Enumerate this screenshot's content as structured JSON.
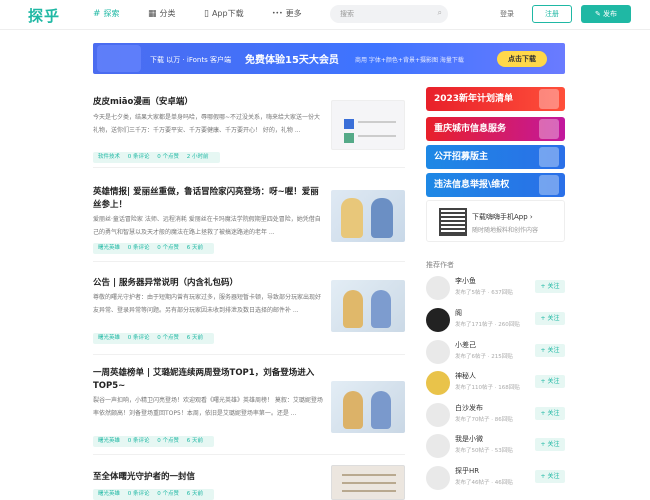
{
  "header": {
    "logo": "探乎",
    "nav": [
      {
        "icon": "#",
        "label": "探索"
      },
      {
        "icon": "▦",
        "label": "分类"
      },
      {
        "icon": "▯",
        "label": "App下载"
      },
      {
        "icon": "•••",
        "label": "更多"
      }
    ],
    "search_placeholder": "搜索",
    "login": "登录",
    "register": "注册",
    "publish": "发布"
  },
  "banner": {
    "left_text": "下载 以万 · iFonts 客户端",
    "main_text": "免费体验15天大会员",
    "sub_text": "商用 字体+颜色+背景+摄影图 海量下载",
    "cta": "点击下载"
  },
  "articles": [
    {
      "title": "皮皮miāo漫画（安卓端）",
      "desc": "今天是七夕类，结果大家都是单身吗哈，辱哪假哪~不过没关系，嗨来给大家送一份大礼物，送你们三千万：千万要平安、千万要健康、千万要开心！ 好的，礼物 ...",
      "tag": "软件技术",
      "comments": "0 条评论",
      "likes": "0 个点赞",
      "time": "2 小时前"
    },
    {
      "title": "英雄情报| 爱丽丝重做，鲁话冒险家闪亮登场：呀~喔！爱丽丝参上！",
      "desc": "爱丽丝·童话冒险家 法师、远程消耗 爱丽丝在卡玛魔法学院假期里四处冒险，她凭借自己的勇气和智慧以及天才般的魔法在路上拯救了被搞迷路途的老年 ...",
      "tag": "曙光英雄",
      "comments": "0 条评论",
      "likes": "0 个点赞",
      "time": "6 天前"
    },
    {
      "title": "公告 | 服务器异常说明（内含礼包码）",
      "desc": "尊敬的曙光守护者：由于短期内曾有玩家过多，服务器短暂卡顿，导致部分玩家出现好友异常、登录异常等问题。另有部分玩家因未收到排泄及数日选择的邮件补 ...",
      "tag": "曙光英雄",
      "comments": "0 条评论",
      "likes": "0 个点赞",
      "time": "6 天前"
    },
    {
      "title": "一周英雄榜单 | 艾璐妮连续两周登场TOP1，刘备登场进入TOP5~",
      "desc": "裂谷一声扣响，小精卫闪亮登场！欢迎观看《曙光英雄》英雄周榜！ 莫叙：艾璐妮登场率依然颇高！刘备登场重回TOP5！本周，依旧是艾璐妮登场率第一。还是 ...",
      "tag": "曙光英雄",
      "comments": "0 条评论",
      "likes": "0 个点赞",
      "time": "6 天前"
    },
    {
      "title": "至全体曙光守护者的一封信",
      "desc": "",
      "tag": "曙光英雄",
      "comments": "0 条评论",
      "likes": "0 个点赞",
      "time": "6 天前"
    }
  ],
  "sidebar": {
    "promos": [
      {
        "label": "2023新年计划清单",
        "color": "#e8202a"
      },
      {
        "label": "重庆城市信息服务",
        "color": "#e8202a"
      },
      {
        "label": "公开招募版主",
        "color": "#1e88e5"
      },
      {
        "label": "违法信息举报\\维权",
        "color": "#1e88e5"
      }
    ],
    "app": {
      "title": "下载嗨嗨手机App",
      "sub": "随时随地报料和创作内容"
    },
    "authors_title": "推荐作者",
    "follow": "+ 关注",
    "authors": [
      {
        "name": "李小鱼",
        "stats": "发布了5帖子 · 637回贴"
      },
      {
        "name": "阁",
        "stats": "发布了171帖子 · 260回贴"
      },
      {
        "name": "小差己",
        "stats": "发布了6帖子 · 215回贴"
      },
      {
        "name": "神秘人",
        "stats": "发布了110帖子 · 168回贴"
      },
      {
        "name": "白沙发布",
        "stats": "发布了70帖子 · 86回贴"
      },
      {
        "name": "我是小微",
        "stats": "发布了50帖子 · 53回贴"
      },
      {
        "name": "探乎HR",
        "stats": "发布了46帖子 · 46回贴"
      }
    ]
  }
}
